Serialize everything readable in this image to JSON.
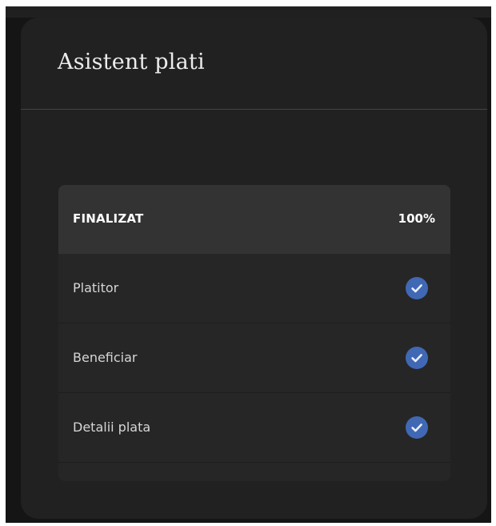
{
  "panel": {
    "title": "Asistent plati"
  },
  "progress": {
    "status_label": "FINALIZAT",
    "percent_label": "100%",
    "completion": 1.0,
    "accent_color": "#4068b4"
  },
  "steps": [
    {
      "label": "Platitor",
      "completed": true,
      "icon": "check-circle-icon"
    },
    {
      "label": "Beneficiar",
      "completed": true,
      "icon": "check-circle-icon"
    },
    {
      "label": "Detalii plata",
      "completed": true,
      "icon": "check-circle-icon"
    }
  ]
}
